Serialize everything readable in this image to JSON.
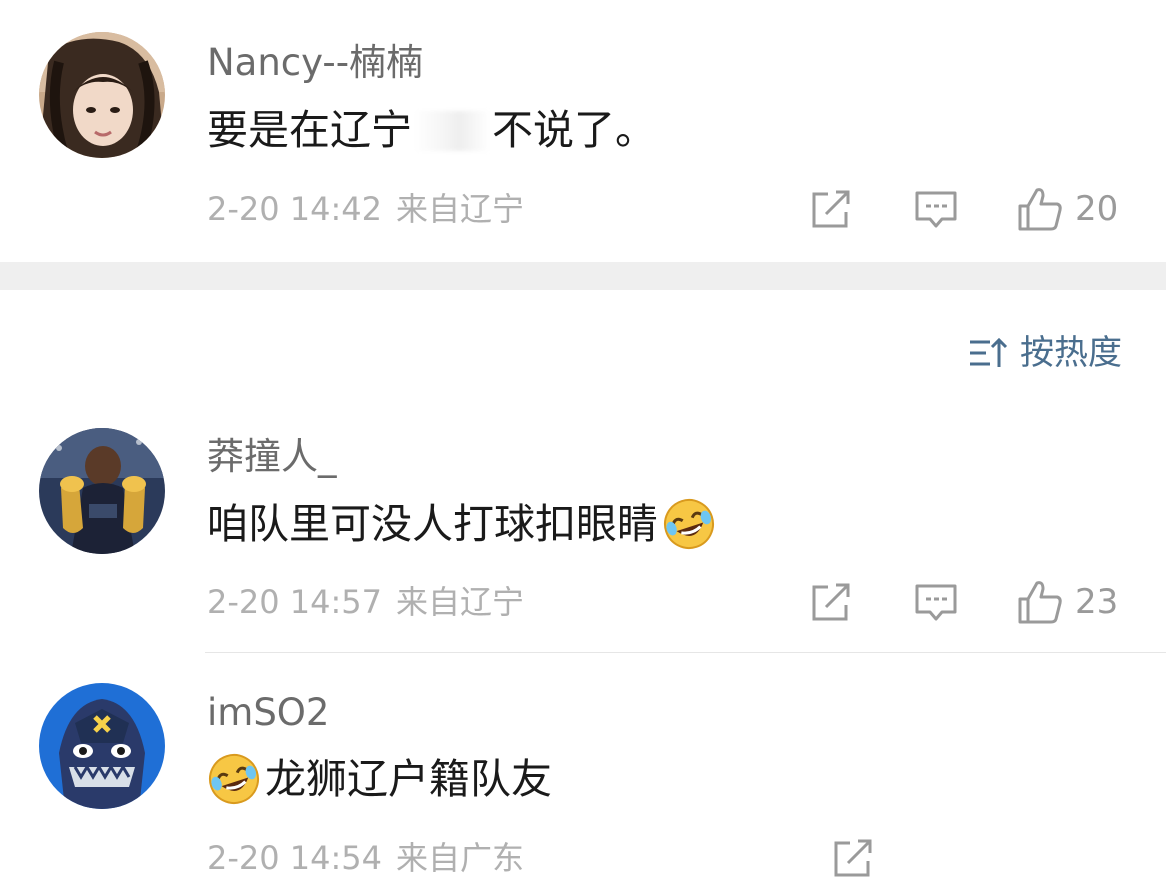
{
  "comments": [
    {
      "username": "Nancy--楠楠",
      "content_before": "要是在辽宁",
      "content_after": "不说了。",
      "time": "2-20 14:42",
      "location": "来自辽宁",
      "likes": "20"
    },
    {
      "username": "莽撞人_",
      "content": "咱队里可没人打球扣眼睛",
      "time": "2-20 14:57",
      "location": "来自辽宁",
      "likes": "23"
    },
    {
      "username": "imSO2",
      "content": "龙狮辽户籍队友",
      "time": "2-20 14:54",
      "location": "来自广东"
    }
  ],
  "sort": {
    "label": "按热度",
    "icon": "sort-icon"
  },
  "icons": {
    "share": "share-icon",
    "comment": "comment-icon",
    "like": "like-icon",
    "emoji": "laughing-crying-emoji"
  },
  "colors": {
    "sort_accent": "#4a6e8e",
    "meta_text": "#b0b0b0",
    "username": "#6b6b6b"
  }
}
